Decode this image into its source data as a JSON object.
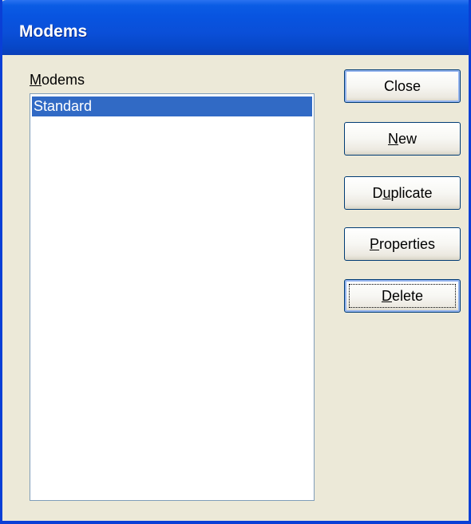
{
  "window": {
    "title": "Modems"
  },
  "list": {
    "label_mnemonic": "M",
    "label_rest": "odems",
    "items": [
      {
        "label": "Standard",
        "selected": true
      }
    ]
  },
  "buttons": {
    "close": {
      "label": "Close"
    },
    "new": {
      "mnemonic": "N",
      "rest": "ew"
    },
    "duplicate": {
      "pre": "D",
      "mnemonic": "u",
      "rest": "plicate"
    },
    "properties": {
      "mnemonic": "P",
      "rest": "roperties"
    },
    "delete": {
      "mnemonic": "D",
      "rest": "elete"
    }
  },
  "colors": {
    "titlebar": "#0a4fd8",
    "selection": "#316ac5",
    "dialog_bg": "#ece9d8",
    "button_border": "#003c74"
  }
}
